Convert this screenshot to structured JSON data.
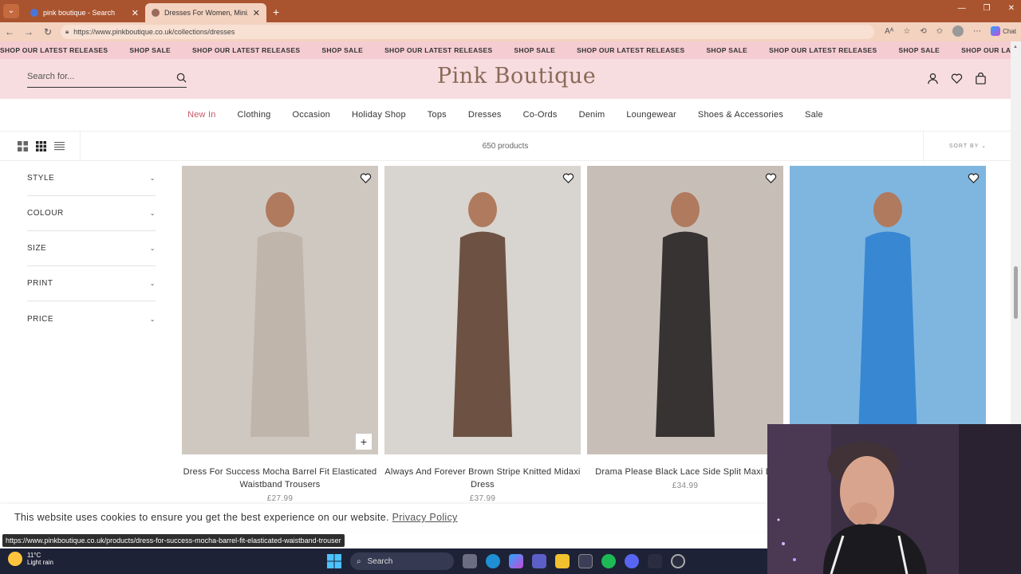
{
  "browser": {
    "tabs": [
      {
        "title": "pink boutique - Search",
        "active": false
      },
      {
        "title": "Dresses For Women, Mini, Maxi &",
        "active": true
      }
    ],
    "url": "https://www.pinkboutique.co.uk/collections/dresses",
    "chat_label": "Chat"
  },
  "marquee": [
    "SHOP OUR LATEST RELEASES",
    "SHOP SALE",
    "SHOP OUR LATEST RELEASES",
    "SHOP SALE",
    "SHOP OUR LATEST RELEASES",
    "SHOP SALE",
    "SHOP OUR LATEST RELEASES",
    "SHOP SALE",
    "SHOP OUR LATEST RELEASES",
    "SHOP SALE",
    "SHOP OUR LATEST RELEASES",
    "SHOP"
  ],
  "header": {
    "search_placeholder": "Search for...",
    "logo": "Pink Boutique"
  },
  "nav": [
    "New In",
    "Clothing",
    "Occasion",
    "Holiday Shop",
    "Tops",
    "Dresses",
    "Co-Ords",
    "Denim",
    "Loungewear",
    "Shoes & Accessories",
    "Sale"
  ],
  "toolbar": {
    "count": "650 products",
    "sort_label": "SORT BY"
  },
  "filters": [
    "STYLE",
    "COLOUR",
    "SIZE",
    "PRINT",
    "PRICE"
  ],
  "products": [
    {
      "name": "Dress For Success Mocha Barrel Fit Elasticated Waistband Trousers",
      "price": "£27.99",
      "bg": "#cfc8c1"
    },
    {
      "name": "Always And Forever Brown Stripe Knitted Midaxi Dress",
      "price": "£37.99",
      "bg": "#d8d4cf"
    },
    {
      "name": "Drama Please Black Lace Side Split Maxi Dr",
      "price": "£34.99",
      "bg": "#c7bfb7"
    },
    {
      "name": "",
      "price": "",
      "bg": "#7fb6e0"
    }
  ],
  "cookie": {
    "text": "This website uses cookies to ensure you get the best experience on our website.",
    "link": "Privacy Policy"
  },
  "status_url": "https://www.pinkboutique.co.uk/products/dress-for-success-mocha-barrel-fit-elasticated-waistband-trouser",
  "taskbar": {
    "temp": "11°C",
    "condition": "Light rain",
    "search": "Search"
  }
}
